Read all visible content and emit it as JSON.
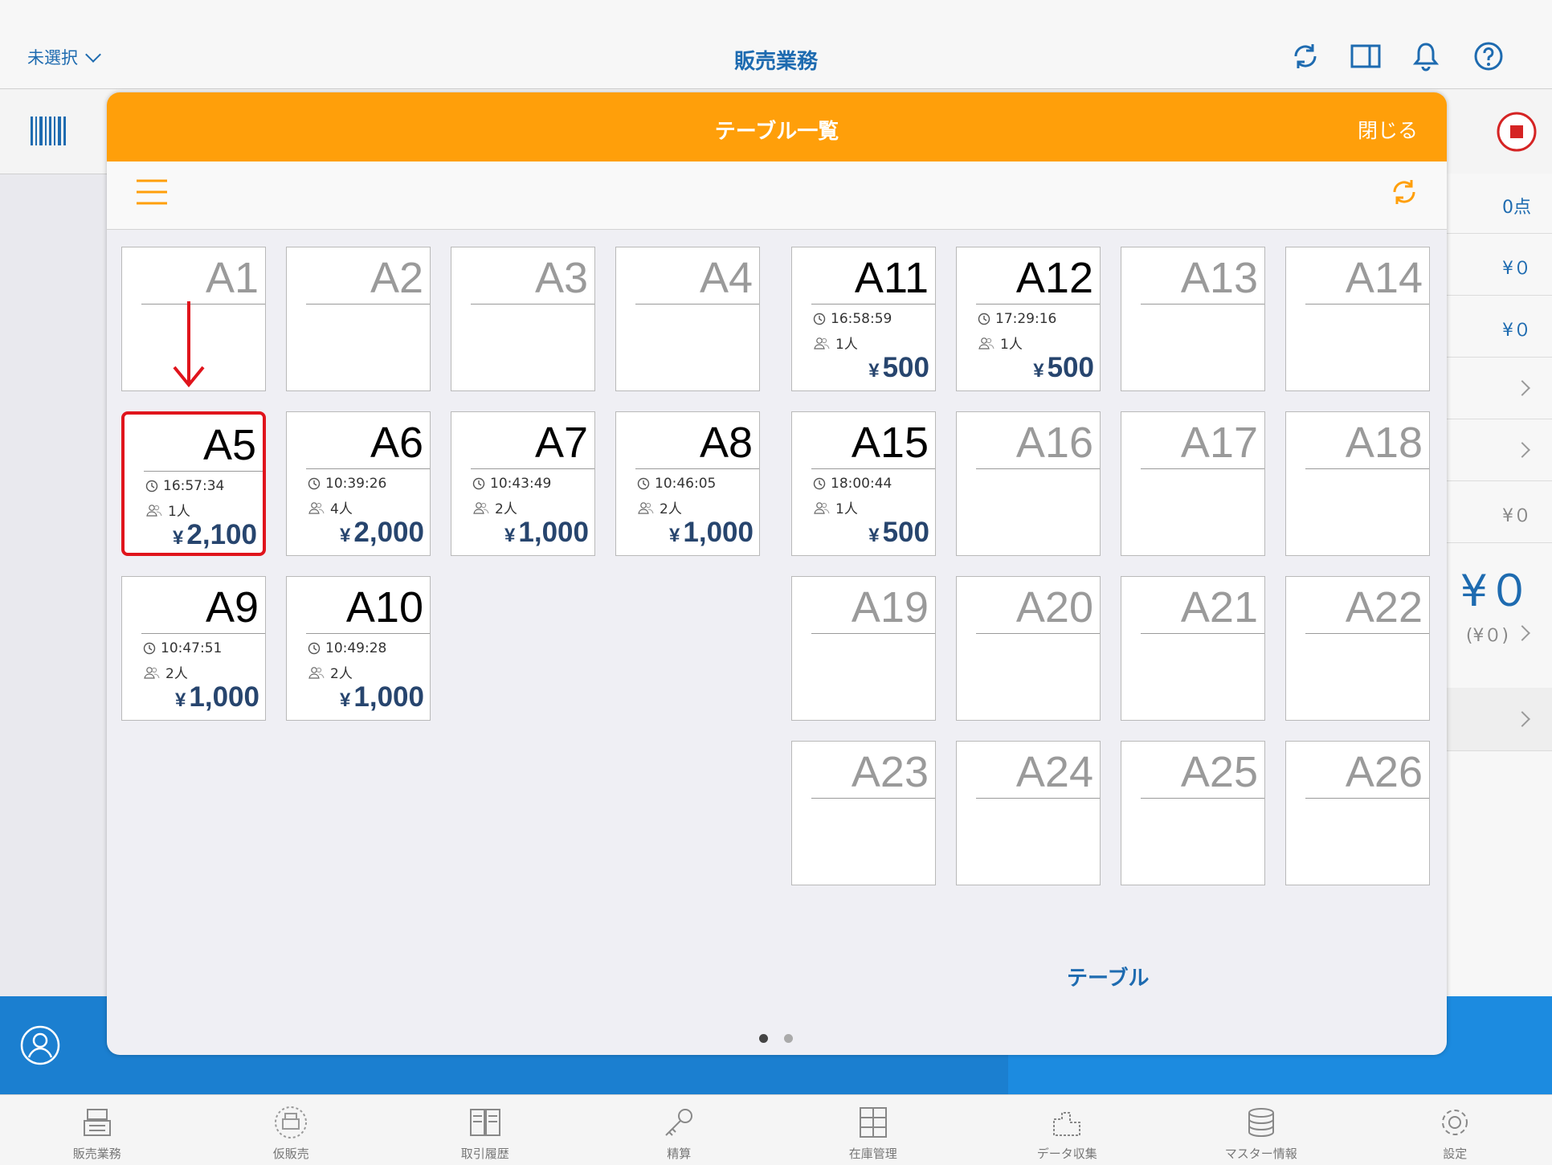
{
  "app": {
    "store_selector": "未選択",
    "title": "販売業務"
  },
  "colors": {
    "accent": "#ff9f0a",
    "brand_blue": "#1e6bb0",
    "highlight_red": "#e0141c",
    "amount_text": "#27456e"
  },
  "background": {
    "points": "0点",
    "rows": [
      {
        "value": "¥０",
        "type": "value"
      },
      {
        "value": "¥０",
        "type": "value"
      },
      {
        "value": "",
        "type": "chevron"
      },
      {
        "value": "",
        "type": "chevron"
      },
      {
        "value": "¥０",
        "type": "value-gray"
      },
      {
        "value": "¥０",
        "type": "big"
      },
      {
        "value": "(¥０)",
        "type": "value-gray-chev"
      },
      {
        "value": "",
        "type": "chevron"
      }
    ]
  },
  "modal": {
    "title": "テーブル一覧",
    "close_label": "閉じる",
    "section_label": "テーブル",
    "page_indicator": {
      "pages": 2,
      "current": 1
    }
  },
  "tables": [
    {
      "name": "A1",
      "occupied": false,
      "time": "",
      "people": "",
      "amount": ""
    },
    {
      "name": "A2",
      "occupied": false,
      "time": "",
      "people": "",
      "amount": ""
    },
    {
      "name": "A3",
      "occupied": false,
      "time": "",
      "people": "",
      "amount": ""
    },
    {
      "name": "A4",
      "occupied": false,
      "time": "",
      "people": "",
      "amount": ""
    },
    {
      "name": "A5",
      "occupied": true,
      "time": "16:57:34",
      "people": "1人",
      "amount": "2,100",
      "selected": true
    },
    {
      "name": "A6",
      "occupied": true,
      "time": "10:39:26",
      "people": "4人",
      "amount": "2,000"
    },
    {
      "name": "A7",
      "occupied": true,
      "time": "10:43:49",
      "people": "2人",
      "amount": "1,000"
    },
    {
      "name": "A8",
      "occupied": true,
      "time": "10:46:05",
      "people": "2人",
      "amount": "1,000"
    },
    {
      "name": "A9",
      "occupied": true,
      "time": "10:47:51",
      "people": "2人",
      "amount": "1,000"
    },
    {
      "name": "A10",
      "occupied": true,
      "time": "10:49:28",
      "people": "2人",
      "amount": "1,000"
    },
    {
      "name": "A11",
      "occupied": true,
      "time": "16:58:59",
      "people": "1人",
      "amount": "500"
    },
    {
      "name": "A12",
      "occupied": true,
      "time": "17:29:16",
      "people": "1人",
      "amount": "500"
    },
    {
      "name": "A13",
      "occupied": false,
      "time": "",
      "people": "",
      "amount": ""
    },
    {
      "name": "A14",
      "occupied": false,
      "time": "",
      "people": "",
      "amount": ""
    },
    {
      "name": "A15",
      "occupied": true,
      "time": "18:00:44",
      "people": "1人",
      "amount": "500"
    },
    {
      "name": "A16",
      "occupied": false,
      "time": "",
      "people": "",
      "amount": ""
    },
    {
      "name": "A17",
      "occupied": false,
      "time": "",
      "people": "",
      "amount": ""
    },
    {
      "name": "A18",
      "occupied": false,
      "time": "",
      "people": "",
      "amount": ""
    },
    {
      "name": "A19",
      "occupied": false,
      "time": "",
      "people": "",
      "amount": ""
    },
    {
      "name": "A20",
      "occupied": false,
      "time": "",
      "people": "",
      "amount": ""
    },
    {
      "name": "A21",
      "occupied": false,
      "time": "",
      "people": "",
      "amount": ""
    },
    {
      "name": "A22",
      "occupied": false,
      "time": "",
      "people": "",
      "amount": ""
    },
    {
      "name": "A23",
      "occupied": false,
      "time": "",
      "people": "",
      "amount": ""
    },
    {
      "name": "A24",
      "occupied": false,
      "time": "",
      "people": "",
      "amount": ""
    },
    {
      "name": "A25",
      "occupied": false,
      "time": "",
      "people": "",
      "amount": ""
    },
    {
      "name": "A26",
      "occupied": false,
      "time": "",
      "people": "",
      "amount": ""
    }
  ],
  "currency_symbol": "¥",
  "bottom_nav": [
    {
      "label": "販売業務",
      "icon": "register-icon"
    },
    {
      "label": "仮販売",
      "icon": "temp-sale-icon"
    },
    {
      "label": "取引履歴",
      "icon": "history-book-icon"
    },
    {
      "label": "精算",
      "icon": "key-icon"
    },
    {
      "label": "在庫管理",
      "icon": "inventory-icon"
    },
    {
      "label": "データ収集",
      "icon": "data-collect-icon"
    },
    {
      "label": "マスター情報",
      "icon": "database-icon"
    },
    {
      "label": "設定",
      "icon": "gear-icon"
    }
  ]
}
